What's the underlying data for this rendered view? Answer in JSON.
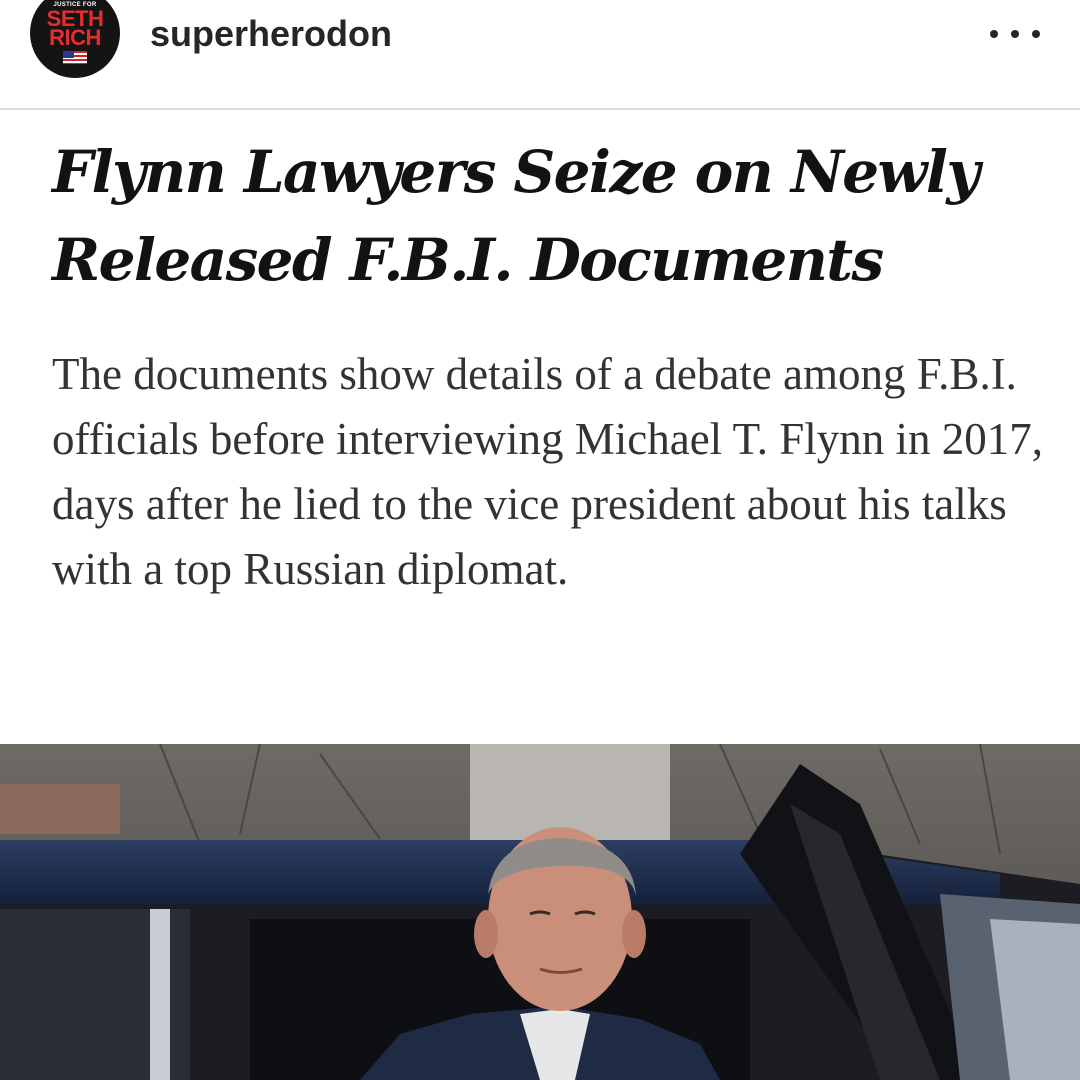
{
  "post_header": {
    "avatar_text": {
      "tagline": "JUSTICE FOR",
      "line1": "SETH",
      "line2": "RICH"
    },
    "username": "superherodon",
    "more_icon": "more-horizontal-icon"
  },
  "article": {
    "headline": "Flynn Lawyers Seize on Newly Released F.B.I. Documents",
    "summary": "The documents show details of a debate among F.B.I. officials before interviewing Michael T. Flynn in 2017, days after he lied to the vice president about his talks with a top Russian diplomat."
  },
  "colors": {
    "avatar_bg": "#141414",
    "avatar_text": "#e52d2d",
    "username": "#262626",
    "headline": "#121212",
    "summary": "#333333",
    "divider": "#dbdbdb"
  }
}
